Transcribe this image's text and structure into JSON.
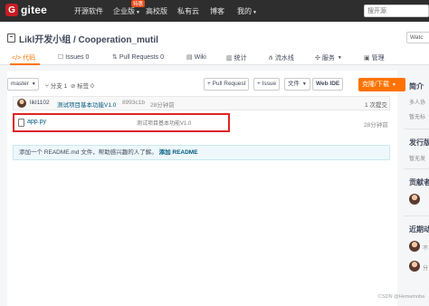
{
  "topnav": {
    "logo_mark": "G",
    "logo_text": "gitee",
    "items": [
      "开源软件",
      "企业版",
      "高校版",
      "私有云",
      "博客",
      "我的"
    ],
    "hot_badge": "特惠",
    "search_placeholder": "搜开源"
  },
  "repo": {
    "title": "Likl开发小组 / Cooperation_mutil",
    "watch_label": "Watc"
  },
  "tabs": [
    "代码",
    "Issues",
    "Pull Requests",
    "Wiki",
    "统计",
    "流水线",
    "服务",
    "管理"
  ],
  "tab_counts": {
    "issues": "0",
    "pull_requests": "0"
  },
  "toolbar": {
    "branch": "master",
    "branch_count": "分支 1",
    "tag_count": "标签 0",
    "pull_request": "+ Pull Request",
    "issue": "+ Issue",
    "file": "文件",
    "web_ide": "Web IDE",
    "clone": "克隆/下载"
  },
  "commit": {
    "author": "likl1102",
    "message": "测试项目基本功能V1.0",
    "hash": "8993c1b",
    "time": "28分钟前",
    "count": "1 次提交"
  },
  "files": [
    {
      "name": "app.py",
      "message": "测试项目基本功能V1.0",
      "time": "28分钟前"
    }
  ],
  "readme": {
    "text": "添加一个 README.md 文件，帮助感兴趣的人了解。",
    "link": "添加 README"
  },
  "sidebar": {
    "intro_title": "简介",
    "intro_desc": "多人协",
    "intro_sub": "暂无标",
    "release_title": "发行版",
    "release_desc": "暂无发",
    "contrib_title": "贡献者",
    "recent_title": "近期动",
    "recent_1": "不",
    "recent_2": "分"
  },
  "watermark": "CSDN @Hemamoba",
  "colors": {
    "accent": "#fe7300",
    "topnav": "#2e2e2e",
    "highlight": "#e02424"
  }
}
